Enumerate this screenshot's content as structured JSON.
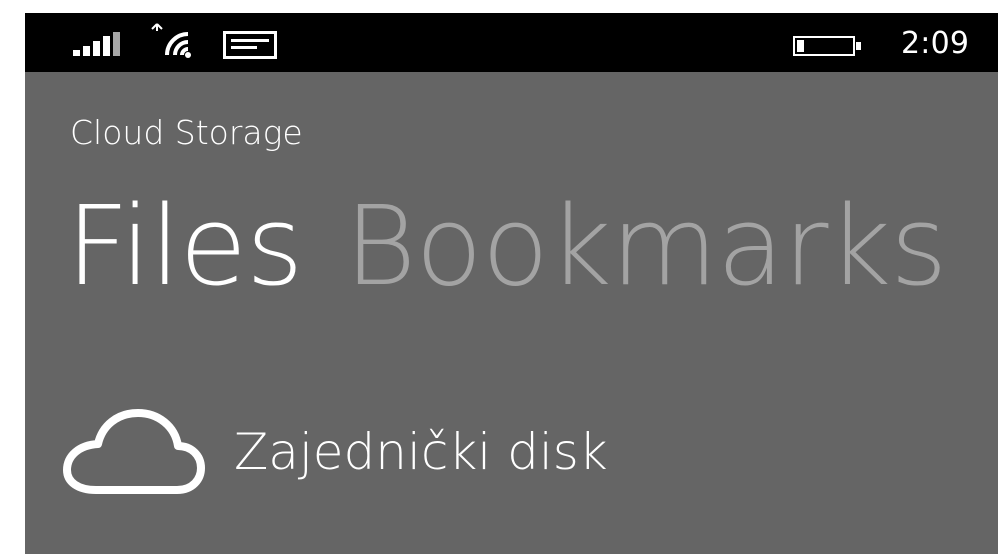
{
  "status_bar": {
    "time": "2:09",
    "icons": [
      "signal-strength-icon",
      "wifi-icon",
      "message-icon",
      "battery-icon"
    ]
  },
  "app": {
    "title": "Cloud Storage"
  },
  "pivot": {
    "tabs": [
      {
        "label": "Files",
        "active": true
      },
      {
        "label": "Bookmarks",
        "active": false
      }
    ]
  },
  "files": [
    {
      "label": "Zajednički disk",
      "icon": "cloud-icon"
    }
  ],
  "colors": {
    "background": "#656565",
    "status_bar": "#000000",
    "text": "#ffffff",
    "inactive_tab": "#a3a3a3"
  }
}
